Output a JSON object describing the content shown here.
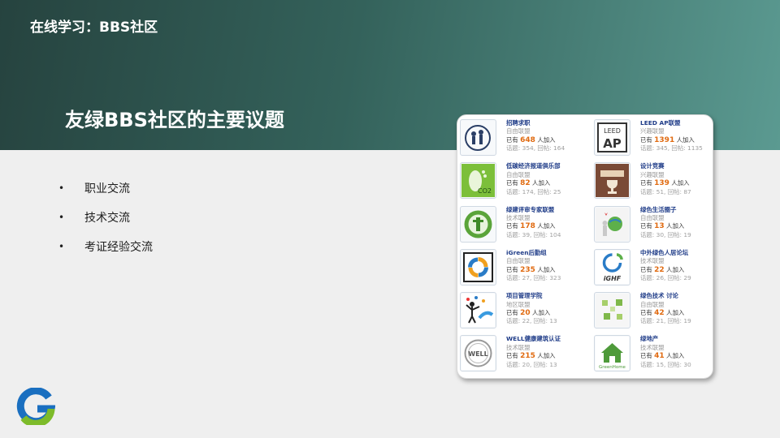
{
  "slide": {
    "top_title": "在线学习：BBS社区",
    "main_title": "友绿BBS社区的主要议题",
    "bullets": [
      "职业交流",
      "技术交流",
      "考证经验交流"
    ],
    "bullet_marker": "•"
  },
  "groups": [
    {
      "name": "招聘求职",
      "type": "自由联盟",
      "prefix": "已有",
      "count": "648",
      "suffix": "人加入",
      "stats": "话题: 354, 回帖: 164",
      "icon": "people-circle-icon"
    },
    {
      "name": "LEED AP联盟",
      "type": "兴趣联盟",
      "prefix": "已有",
      "count": "1391",
      "suffix": "人加入",
      "stats": "话题: 345, 回帖: 1135",
      "icon": "leed-ap-badge-icon",
      "badge_top": "LEED",
      "badge_bottom": "AP"
    },
    {
      "name": "低碳经济报道俱乐部",
      "type": "自由联盟",
      "prefix": "已有",
      "count": "82",
      "suffix": "人加入",
      "stats": "话题: 174, 回帖: 25",
      "icon": "co2-footprint-icon",
      "badge_text": "CO2"
    },
    {
      "name": "设计竞赛",
      "type": "兴趣联盟",
      "prefix": "已有",
      "count": "139",
      "suffix": "人加入",
      "stats": "话题: 51, 回帖: 87",
      "icon": "trophy-banner-icon"
    },
    {
      "name": "绿建评审专家联盟",
      "type": "技术联盟",
      "prefix": "已有",
      "count": "178",
      "suffix": "人加入",
      "stats": "话题: 39, 回帖: 104",
      "icon": "green-seal-icon"
    },
    {
      "name": "绿色生活圈子",
      "type": "自由联盟",
      "prefix": "已有",
      "count": "13",
      "suffix": "人加入",
      "stats": "话题: 30, 回帖: 19",
      "icon": "globe-figure-icon"
    },
    {
      "name": "iGreen后勤组",
      "type": "自由联盟",
      "prefix": "已有",
      "count": "235",
      "suffix": "人加入",
      "stats": "话题: 27, 回帖: 323",
      "icon": "swirl-logo-icon"
    },
    {
      "name": "中外绿色人居论坛",
      "type": "技术联盟",
      "prefix": "已有",
      "count": "22",
      "suffix": "人加入",
      "stats": "话题: 26, 回帖: 29",
      "icon": "ighf-logo-icon",
      "badge_text": "iGHF"
    },
    {
      "name": "项目管理学院",
      "type": "地区联盟",
      "prefix": "已有",
      "count": "20",
      "suffix": "人加入",
      "stats": "话题: 22, 回帖: 13",
      "icon": "juggler-figure-icon"
    },
    {
      "name": "绿色技术 讨论",
      "type": "自由联盟",
      "prefix": "已有",
      "count": "42",
      "suffix": "人加入",
      "stats": "话题: 21, 回帖: 19",
      "icon": "green-cubes-icon"
    },
    {
      "name": "WELL健康建筑认证",
      "type": "技术联盟",
      "prefix": "已有",
      "count": "215",
      "suffix": "人加入",
      "stats": "话题: 20, 回帖: 13",
      "icon": "well-logo-icon",
      "badge_text": "WELL"
    },
    {
      "name": "绿地产",
      "type": "技术联盟",
      "prefix": "已有",
      "count": "41",
      "suffix": "人加入",
      "stats": "话题: 15, 回帖: 30",
      "icon": "green-home-icon",
      "badge_text": "GreenHome"
    }
  ],
  "colors": {
    "header_dark": "#26433f",
    "header_light": "#5b9a91",
    "count_orange": "#e06a10",
    "group_name_blue": "#1f3c88",
    "logo_blue": "#1a6fc0",
    "logo_green": "#7dbb2a"
  },
  "logo": {
    "icon": "g-brand-logo"
  }
}
